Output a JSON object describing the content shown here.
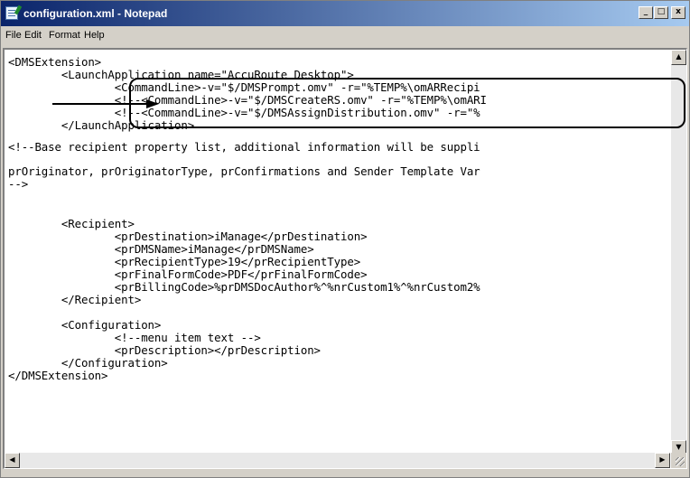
{
  "window": {
    "title": "configuration.xml - Notepad",
    "minimize_glyph": "_",
    "maximize_glyph": "□",
    "close_glyph": "x"
  },
  "menu": [
    "File",
    "Edit",
    "Format",
    "Help"
  ],
  "content_lines": [
    "<DMSExtension>",
    "        <LaunchApplication name=\"AccuRoute Desktop\">",
    "                <CommandLine>-v=\"$/DMSPrompt.omv\" -r=\"%TEMP%\\omARRecipi",
    "                <!--<CommandLine>-v=\"$/DMSCreateRS.omv\" -r=\"%TEMP%\\omARI",
    "                <!--<CommandLine>-v=\"$/DMSAssignDistribution.omv\" -r=\"%",
    "        </LaunchApplication>",
    "",
    "<!--Base recipient property list, additional information will be suppli",
    "",
    "prOriginator, prOriginatorType, prConfirmations and Sender Template Var",
    "-->",
    "",
    "",
    "        <Recipient>",
    "                <prDestination>iManage</prDestination>",
    "                <prDMSName>iManage</prDMSName>",
    "                <prRecipientType>19</prRecipientType>",
    "                <prFinalFormCode>PDF</prFinalFormCode>",
    "                <prBillingCode>%prDMSDocAuthor%^%nrCustom1%^%nrCustom2%",
    "        </Recipient>",
    "",
    "        <Configuration>",
    "                <!--menu item text -->",
    "                <prDescription></prDescription>",
    "        </Configuration>",
    "</DMSExtension>"
  ],
  "icons": {
    "app": "notepad-icon",
    "scroll_up": "arrow-up-icon",
    "scroll_down": "arrow-down-icon",
    "scroll_left": "arrow-left-icon",
    "scroll_right": "arrow-right-icon"
  },
  "colors": {
    "titlebar_start": "#0a246a",
    "titlebar_end": "#a6caf0",
    "chrome": "#d4d0c8"
  }
}
